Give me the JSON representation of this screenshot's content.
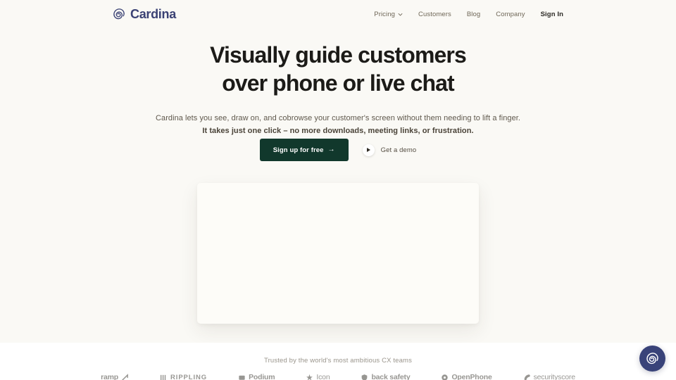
{
  "brand": {
    "name": "Cardina",
    "logo_icon": "spiral-logo-icon",
    "logo_color": "#3b4274"
  },
  "nav": {
    "items": [
      {
        "label": "Pricing",
        "has_dropdown": true,
        "icon": "chevron-down-icon",
        "strong": false
      },
      {
        "label": "Customers",
        "has_dropdown": false,
        "strong": false
      },
      {
        "label": "Blog",
        "has_dropdown": false,
        "strong": false
      },
      {
        "label": "Company",
        "has_dropdown": false,
        "strong": false
      },
      {
        "label": "Sign In",
        "has_dropdown": false,
        "strong": true
      }
    ]
  },
  "hero": {
    "headline_line_1": "Visually guide customers",
    "headline_line_2": "over phone or live chat",
    "subhead_line_1": "Cardina lets you see, draw on, and cobrowse your customer's screen without them needing to lift a finger.",
    "subhead_line_2": "It takes just one click – no more downloads, meeting links, or frustration.",
    "primary_cta": "Sign up for free",
    "primary_cta_arrow": "→",
    "secondary_cta": "Get a demo",
    "secondary_cta_icon": "play-icon",
    "media_placeholder": "hero-video-card"
  },
  "trust": {
    "caption": "Trusted by the world's most ambitious CX teams",
    "logos": [
      {
        "name": "ramp",
        "style": "lower",
        "glyph": "ramp-mark-icon"
      },
      {
        "name": "RIPPLING",
        "style": "caps",
        "glyph": "rippling-mark-icon"
      },
      {
        "name": "Podium",
        "style": "lower",
        "glyph": "podium-mark-icon"
      },
      {
        "name": "Icon",
        "style": "light",
        "glyph": "icon-mark-icon"
      },
      {
        "name": "back safety",
        "style": "lower",
        "glyph": "back-safety-mark-icon"
      },
      {
        "name": "OpenPhone",
        "style": "lower",
        "glyph": "openphone-mark-icon"
      },
      {
        "name": "securityscore",
        "style": "light",
        "glyph": "securityscore-mark-icon"
      }
    ]
  },
  "chat": {
    "icon": "cardina-chat-icon",
    "color": "#394379"
  },
  "theme": {
    "hero_background": "#faf9f5",
    "page_background": "#ffffff",
    "primary_button": "#11382c",
    "headline_color": "#1c1b18",
    "nav_color": "#6f6757"
  }
}
